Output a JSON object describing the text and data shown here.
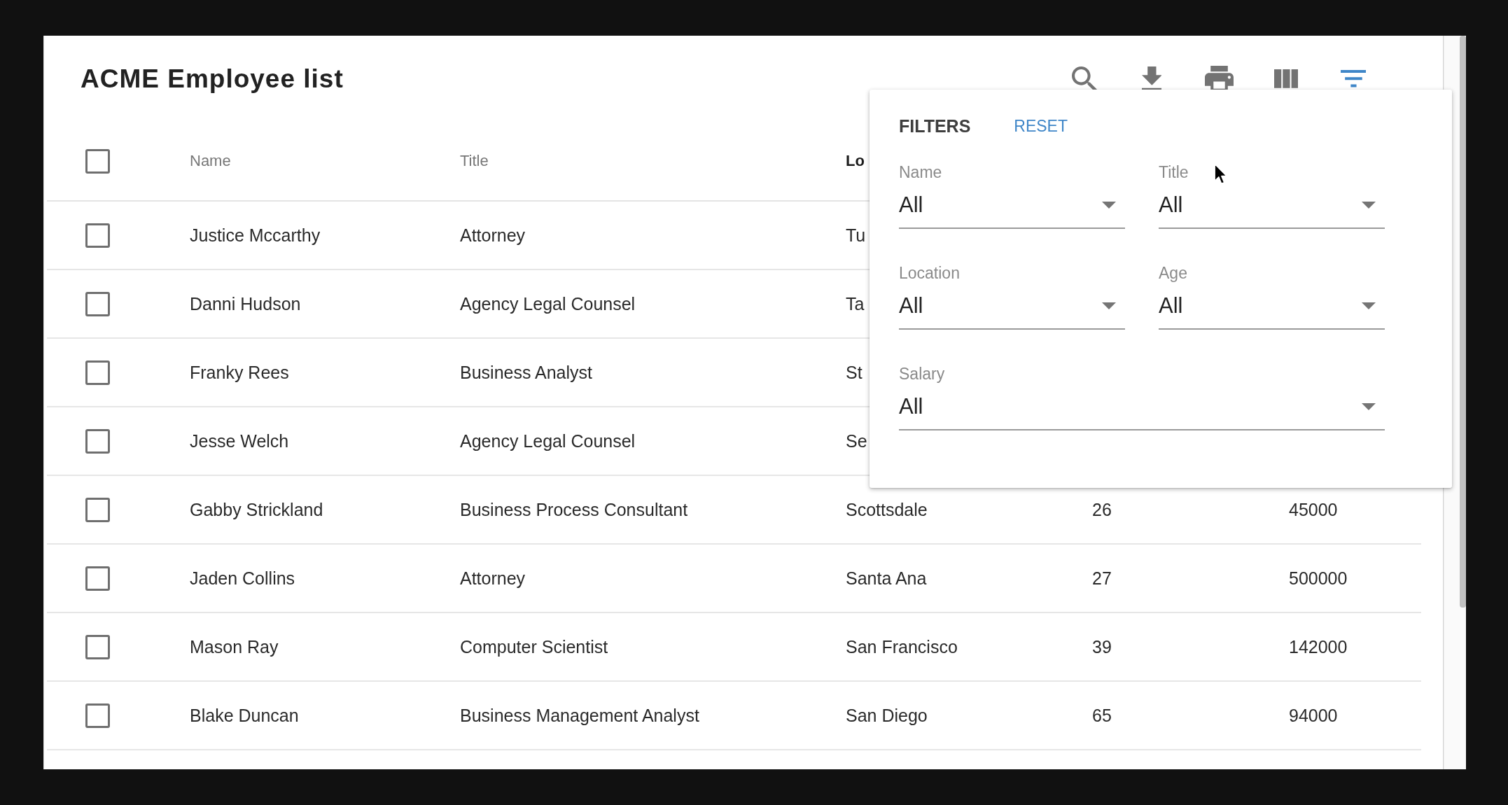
{
  "title": "ACME Employee list",
  "toolbar": [
    {
      "kind": "search",
      "active": false
    },
    {
      "kind": "download",
      "active": false
    },
    {
      "kind": "print",
      "active": false
    },
    {
      "kind": "columns",
      "active": false
    },
    {
      "kind": "filter",
      "active": true
    }
  ],
  "table": {
    "select_all": {
      "checked": false
    },
    "columns": [
      {
        "label": "Name",
        "sorted": false
      },
      {
        "label": "Title",
        "sorted": false
      },
      {
        "label": "Lo",
        "sorted": true
      }
    ],
    "rows": [
      {
        "checked": false,
        "cells": [
          "Justice Mccarthy",
          "Attorney",
          "Tu"
        ]
      },
      {
        "checked": false,
        "cells": [
          "Danni Hudson",
          "Agency Legal Counsel",
          "Ta"
        ]
      },
      {
        "checked": false,
        "cells": [
          "Franky Rees",
          "Business Analyst",
          "St"
        ]
      },
      {
        "checked": false,
        "cells": [
          "Jesse Welch",
          "Agency Legal Counsel",
          "Se"
        ]
      },
      {
        "checked": false,
        "cells": [
          "Gabby Strickland",
          "Business Process Consultant",
          "Scottsdale",
          "26",
          "45000"
        ]
      },
      {
        "checked": false,
        "cells": [
          "Jaden Collins",
          "Attorney",
          "Santa Ana",
          "27",
          "500000"
        ]
      },
      {
        "checked": false,
        "cells": [
          "Mason Ray",
          "Computer Scientist",
          "San Francisco",
          "39",
          "142000"
        ]
      },
      {
        "checked": false,
        "cells": [
          "Blake Duncan",
          "Business Management Analyst",
          "San Diego",
          "65",
          "94000"
        ]
      }
    ]
  },
  "filters": {
    "title": "FILTERS",
    "reset": "RESET",
    "fields": [
      {
        "label": "Name",
        "value": "All"
      },
      {
        "label": "Title",
        "value": "All"
      },
      {
        "label": "Location",
        "value": "All"
      },
      {
        "label": "Age",
        "value": "All"
      },
      {
        "label": "Salary",
        "value": "All"
      }
    ]
  }
}
